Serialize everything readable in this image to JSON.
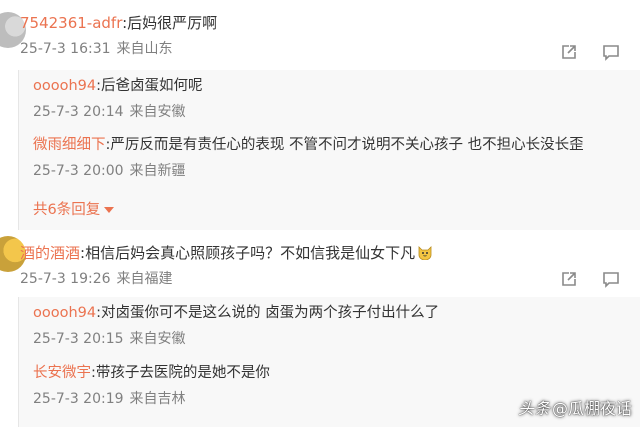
{
  "comments": [
    {
      "user": "7542361-adfr",
      "text": ":后妈很严厉啊",
      "date": "25-7-3 16:31",
      "location": "来自山东",
      "replies": [
        {
          "user": "ooooh94",
          "text": ":后爸卤蛋如何呢",
          "date": "25-7-3 20:14",
          "location": "来自安徽"
        },
        {
          "user": "微雨细细下",
          "text": ":严厉反而是有责任心的表现  不管不问才说明不关心孩子  也不担心长没长歪",
          "date": "25-7-3 20:00",
          "location": "来自新疆"
        }
      ],
      "more_replies": "共6条回复"
    },
    {
      "user": "酒的酒酒",
      "text": ":相信后妈会真心照顾孩子吗？不如信我是仙女下凡",
      "emoji": "cat-face-emoji",
      "date": "25-7-3 19:26",
      "location": "来自福建",
      "replies": [
        {
          "user": "ooooh94",
          "text": ":对卤蛋你可不是这么说的  卤蛋为两个孩子付出什么了",
          "date": "25-7-3 20:15",
          "location": "来自安徽"
        },
        {
          "user": "长安微宇",
          "text": ":带孩子去医院的是她不是你",
          "date": "25-7-3 20:19",
          "location": "来自吉林"
        }
      ]
    }
  ],
  "icons": {
    "share": "share-icon",
    "comment": "comment-icon"
  },
  "watermark": {
    "platform": "头条",
    "account": "@瓜棚夜话"
  },
  "colors": {
    "username": "#eb7350",
    "meta": "#808080",
    "reply_bg": "#f8f8f8"
  }
}
